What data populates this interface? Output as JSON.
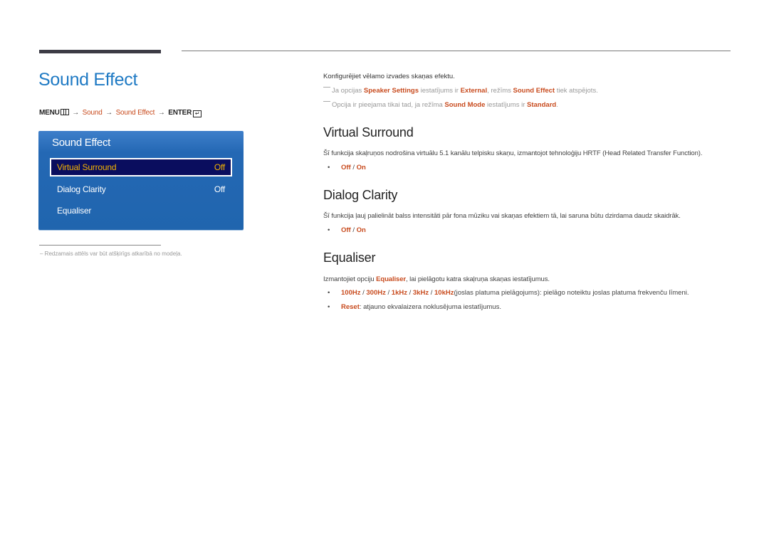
{
  "page": {
    "title": "Sound Effect"
  },
  "breadcrumb": {
    "menu": "MENU",
    "menu_icon": "menu-grid-icon",
    "arrow": "→",
    "items": [
      "Sound",
      "Sound Effect"
    ],
    "enter": "ENTER",
    "enter_icon": "enter-return-icon",
    "enter_glyph": "↵"
  },
  "osd_menu": {
    "title": "Sound Effect",
    "items": [
      {
        "label": "Virtual Surround",
        "value": "Off",
        "selected": true
      },
      {
        "label": "Dialog Clarity",
        "value": "Off",
        "selected": false
      },
      {
        "label": "Equaliser",
        "value": "",
        "selected": false
      }
    ]
  },
  "footnote": "–  Redzamais attēls var būt atšķirīgs atkarībā no modeļa.",
  "intro": {
    "text": "Konfigurējiet vēlamo izvades skaņas efektu.",
    "notes": [
      {
        "parts": [
          {
            "t": "Ja opcijas ",
            "hl": false
          },
          {
            "t": "Speaker Settings",
            "hl": true
          },
          {
            "t": " iestatījums ir ",
            "hl": false
          },
          {
            "t": "External",
            "hl": true
          },
          {
            "t": ", režīms ",
            "hl": false
          },
          {
            "t": "Sound Effect",
            "hl": true
          },
          {
            "t": " tiek atspējots.",
            "hl": false
          }
        ]
      },
      {
        "parts": [
          {
            "t": "Opcija ir pieejama tikai tad, ja režīma ",
            "hl": false
          },
          {
            "t": "Sound Mode",
            "hl": true
          },
          {
            "t": " iestatījums ir ",
            "hl": false
          },
          {
            "t": "Standard",
            "hl": true
          },
          {
            "t": ".",
            "hl": false
          }
        ]
      }
    ]
  },
  "sections": {
    "virtual_surround": {
      "title": "Virtual Surround",
      "desc": "Šī funkcija skaļruņos nodrošina virtuālu 5.1 kanālu telpisku skaņu, izmantojot tehnoloģiju HRTF (Head Related Transfer Function).",
      "options": {
        "off": "Off",
        "sep": " / ",
        "on": "On"
      }
    },
    "dialog_clarity": {
      "title": "Dialog Clarity",
      "desc": "Šī funkcija ļauj palielināt balss intensitāti pār fona mūziku vai skaņas efektiem tā, lai saruna būtu dzirdama daudz skaidrāk.",
      "options": {
        "off": "Off",
        "sep": " / ",
        "on": "On"
      }
    },
    "equaliser": {
      "title": "Equaliser",
      "desc_pre": "Izmantojiet opciju ",
      "desc_hl": "Equaliser",
      "desc_post": ", lai pielāgotu katra skaļruņa skaņas iestatījumus.",
      "bands": [
        "100Hz",
        "300Hz",
        "1kHz",
        "3kHz",
        "10kHz"
      ],
      "band_sep": " / ",
      "bands_desc": "(joslas platuma pielāgojums): pielāgo noteiktu joslas platuma frekvenču līmeni.",
      "reset_label": "Reset",
      "reset_desc": ": atjauno ekvalaizera noklusējuma iestatījumus."
    }
  },
  "bullet_char": "•",
  "colors": {
    "title_blue": "#1f7ac4",
    "accent_orange": "#c84b1e",
    "panel_blue": "#2065ae",
    "selected_bg": "#0a0d5e",
    "selected_text": "#f5b400"
  }
}
